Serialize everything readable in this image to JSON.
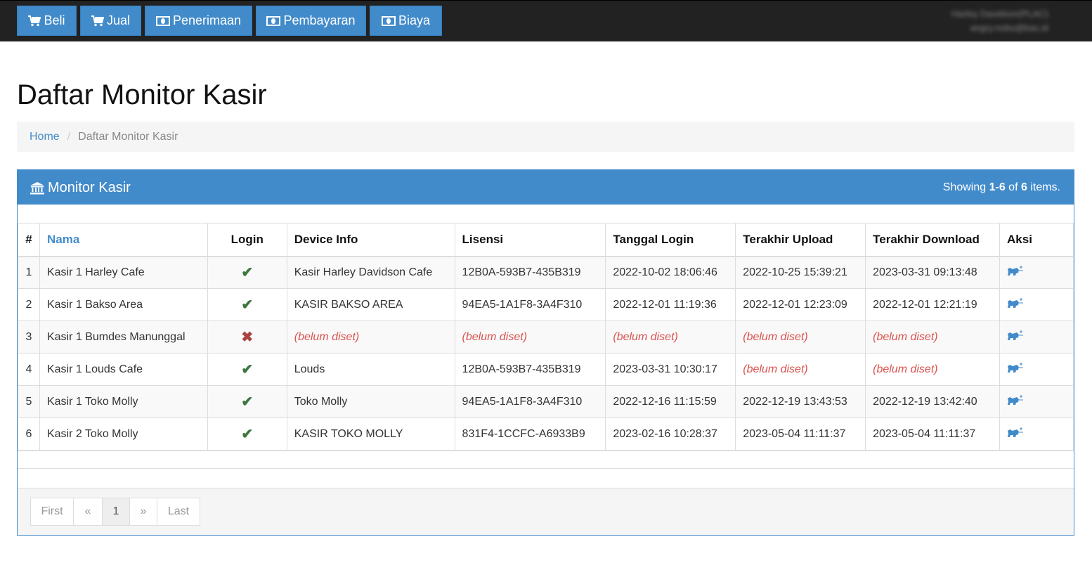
{
  "nav": {
    "items": [
      {
        "label": "Beli",
        "icon": "cart-icon"
      },
      {
        "label": "Jual",
        "icon": "cart-icon"
      },
      {
        "label": "Penerimaan",
        "icon": "money-icon"
      },
      {
        "label": "Pembayaran",
        "icon": "money-icon"
      },
      {
        "label": "Biaya",
        "icon": "money-icon"
      }
    ],
    "user_line1": "Harley Davidson(PLAC)",
    "user_line2": "angry.nobu@kas.id"
  },
  "page_title": "Daftar Monitor Kasir",
  "breadcrumb": {
    "home": "Home",
    "separator": "/",
    "current": "Daftar Monitor Kasir"
  },
  "panel": {
    "title": "Monitor Kasir",
    "icon": "bank-icon",
    "summary_prefix": "Showing ",
    "summary_range": "1-6",
    "summary_mid": " of ",
    "summary_total": "6",
    "summary_suffix": " items."
  },
  "table": {
    "headers": {
      "num": "#",
      "nama": "Nama",
      "login": "Login",
      "device": "Device Info",
      "lisensi": "Lisensi",
      "tanggal": "Tanggal Login",
      "upload": "Terakhir Upload",
      "download": "Terakhir Download",
      "aksi": "Aksi"
    },
    "rows": [
      {
        "num": "1",
        "nama": "Kasir 1 Harley Cafe",
        "login": "✔",
        "device": "Kasir Harley Davidson Cafe",
        "lisensi": "12B0A-593B7-435B319",
        "tanggal": "2022-10-02 18:06:46",
        "upload": "2022-10-25 15:39:21",
        "download": "2023-03-31 09:13:48"
      },
      {
        "num": "2",
        "nama": "Kasir 1 Bakso Area",
        "login": "✔",
        "device": "KASIR BAKSO AREA",
        "lisensi": "94EA5-1A1F8-3A4F310",
        "tanggal": "2022-12-01 11:19:36",
        "upload": "2022-12-01 12:23:09",
        "download": "2022-12-01 12:21:19"
      },
      {
        "num": "3",
        "nama": "Kasir 1 Bumdes Manunggal",
        "login": "✖",
        "device": "(belum diset)",
        "lisensi": "(belum diset)",
        "tanggal": "(belum diset)",
        "upload": "(belum diset)",
        "download": "(belum diset)"
      },
      {
        "num": "4",
        "nama": "Kasir 1 Louds Cafe",
        "login": "✔",
        "device": "Louds",
        "lisensi": "12B0A-593B7-435B319",
        "tanggal": "2023-03-31 10:30:17",
        "upload": "(belum diset)",
        "download": "(belum diset)"
      },
      {
        "num": "5",
        "nama": "Kasir 1 Toko Molly",
        "login": "✔",
        "device": "Toko Molly",
        "lisensi": "94EA5-1A1F8-3A4F310",
        "tanggal": "2022-12-16 11:15:59",
        "upload": "2022-12-19 13:43:53",
        "download": "2022-12-19 13:42:40"
      },
      {
        "num": "6",
        "nama": "Kasir 2 Toko Molly",
        "login": "✔",
        "device": "KASIR TOKO MOLLY",
        "lisensi": "831F4-1CCFC-A6933B9",
        "tanggal": "2023-02-16 10:28:37",
        "upload": "2023-05-04 11:11:37",
        "download": "2023-05-04 11:11:37"
      }
    ],
    "action_icon": "monitor-action-icon"
  },
  "pagination": {
    "first": "First",
    "prev": "«",
    "page": "1",
    "next": "»",
    "last": "Last"
  },
  "colors": {
    "primary": "#428bca",
    "topbar": "#222222",
    "unset": "#d9534f",
    "check": "#3c763d",
    "cross": "#a94442"
  }
}
